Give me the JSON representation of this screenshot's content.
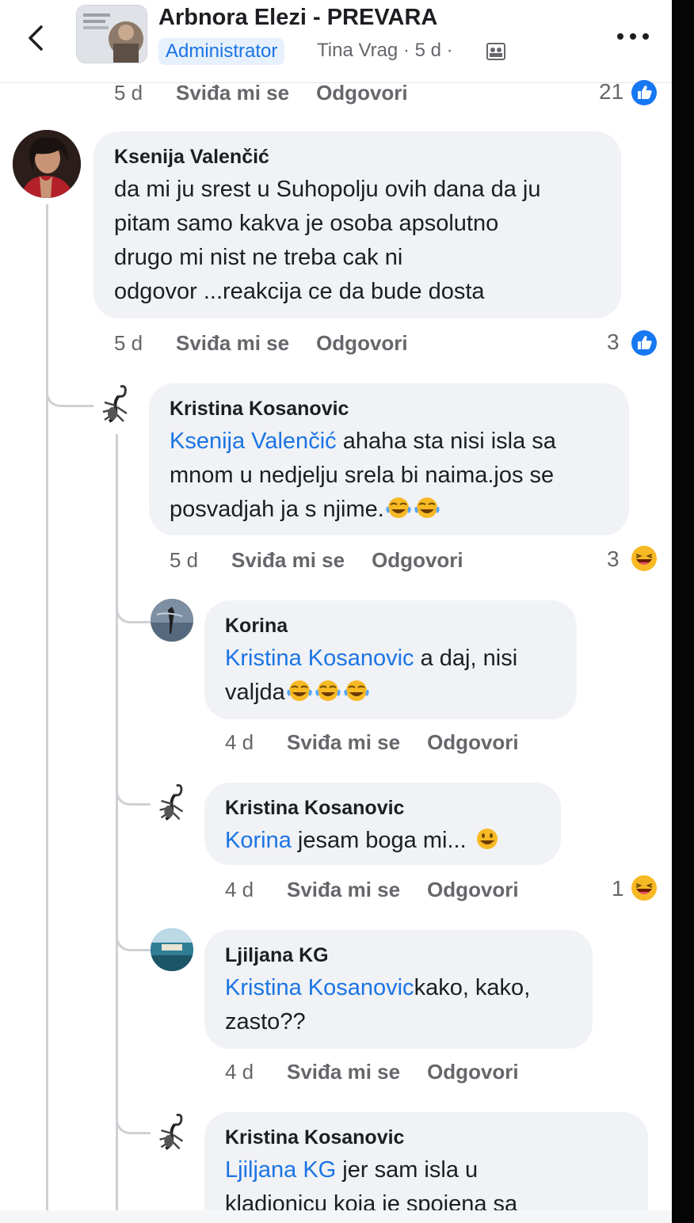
{
  "header": {
    "title": "Arbnora Elezi - PREVARA",
    "badge": "Administrator",
    "meta": "Tina Vrag · 5 d ·"
  },
  "top_strip": {
    "time": "5 d",
    "like": "Sviđa mi se",
    "reply": "Odgovori",
    "count": "21"
  },
  "comments": [
    {
      "author": "Ksenija Valenčić",
      "lines": [
        "da mi ju srest u Suhopolju ovih dana da ju",
        "pitam samo kakva je osoba apsolutno",
        "drugo mi nist ne treba cak ni",
        "odgovor ...reakcija ce da bude dosta"
      ],
      "time": "5 d",
      "like": "Sviđa mi se",
      "reply": "Odgovori",
      "reaction_count": "3"
    },
    {
      "author": "Kristina Kosanovic",
      "mention": "Ksenija Valenčić",
      "line1": " ahaha sta nisi isla sa",
      "line2": "mnom u nedjelju srela bi naima.jos se",
      "line3": "posvadjah ja s njime.",
      "time": "5 d",
      "like": "Sviđa mi se",
      "reply": "Odgovori",
      "reaction_count": "3"
    },
    {
      "author": "Korina",
      "mention": "Kristina Kosanovic",
      "line1": " a daj, nisi",
      "line2": "valjda",
      "time": "4 d",
      "like": "Sviđa mi se",
      "reply": "Odgovori"
    },
    {
      "author": "Kristina Kosanovic",
      "mention": "Korina",
      "line1": " jesam boga mi...",
      "time": "4 d",
      "like": "Sviđa mi se",
      "reply": "Odgovori",
      "reaction_count": "1"
    },
    {
      "author": "Ljiljana KG",
      "mention": "Kristina Kosanovic",
      "line1": "kako, kako,",
      "line2": "zasto??",
      "time": "4 d",
      "like": "Sviđa mi se",
      "reply": "Odgovori"
    },
    {
      "author": "Kristina Kosanovic",
      "mention": "Ljiljana KG",
      "line1": " jer sam isla u",
      "line2": "kladionicu koja je spojena sa"
    }
  ],
  "colors": {
    "link": "#1b74e4",
    "bubble": "#f0f2f5",
    "muted": "#65676b",
    "like_blue": "#1877f2"
  }
}
